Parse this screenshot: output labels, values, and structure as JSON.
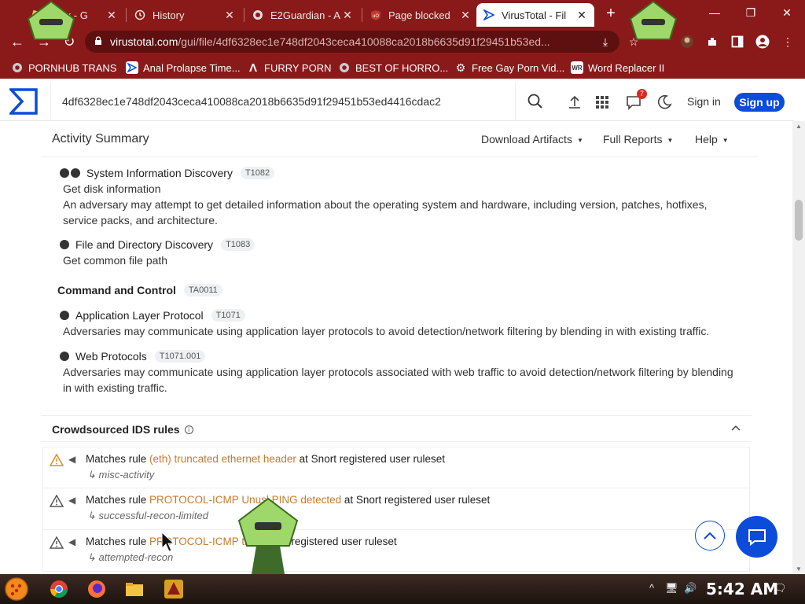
{
  "browser": {
    "tabs": [
      {
        "label": "obux - G",
        "icon": "robux-icon"
      },
      {
        "label": "History",
        "icon": "history-icon"
      },
      {
        "label": "E2Guardian - A",
        "icon": "globe-icon"
      },
      {
        "label": "Page blocked",
        "icon": "ublock-icon"
      },
      {
        "label": "VirusTotal - Fil",
        "icon": "virustotal-icon",
        "active": true
      }
    ],
    "new_tab": "+",
    "window_controls": {
      "minimize": "—",
      "restore": "❐",
      "close": "✕"
    },
    "url_host": "virustotal.com",
    "url_path": "/gui/file/4df6328ec1e748df2043ceca410088ca2018b6635d91f29451b53ed...",
    "bookmarks": [
      {
        "label": "PORNHUB TRANS",
        "icon": "globe-icon"
      },
      {
        "label": "Anal Prolapse Time...",
        "icon": "virustotal-icon"
      },
      {
        "label": "FURRY PORN",
        "icon": "lambda-icon"
      },
      {
        "label": "BEST OF HORRO...",
        "icon": "globe-icon"
      },
      {
        "label": "Free Gay Porn Vid...",
        "icon": "gear-icon"
      },
      {
        "label": "Word Replacer II",
        "icon": "word-replacer-icon"
      }
    ]
  },
  "vt": {
    "search_value": "4df6328ec1e748df2043ceca410088ca2018b6635d91f29451b53ed4416cdac2",
    "notifications_count": "7",
    "sign_in": "Sign in",
    "sign_up": "Sign up"
  },
  "activity": {
    "title": "Activity Summary",
    "menus": [
      "Download Artifacts",
      "Full Reports",
      "Help"
    ],
    "techniques": [
      {
        "name": "System Information Discovery",
        "id": "T1082",
        "detail": "Get disk information",
        "desc": "An adversary may attempt to get detailed information about the operating system and hardware, including version, patches, hotfixes, service packs, and architecture."
      },
      {
        "name": "File and Directory Discovery",
        "id": "T1083",
        "detail": "Get common file path",
        "desc": ""
      }
    ],
    "tactic": {
      "name": "Command and Control",
      "id": "TA0011"
    },
    "c2_techniques": [
      {
        "name": "Application Layer Protocol",
        "id": "T1071",
        "desc": "Adversaries may communicate using application layer protocols to avoid detection/network filtering by blending in with existing traffic."
      },
      {
        "name": "Web Protocols",
        "id": "T1071.001",
        "desc": "Adversaries may communicate using application layer protocols associated with web traffic to avoid detection/network filtering by blending in with existing traffic."
      }
    ]
  },
  "ids": {
    "title": "Crowdsourced IDS rules",
    "rules": [
      {
        "prefix": "Matches rule ",
        "rule": "(eth) truncated ethernet header",
        "suffix": " at Snort registered user ruleset",
        "category": "misc-activity"
      },
      {
        "prefix": "Matches rule ",
        "rule": "PROTOCOL-ICMP Unus",
        "rule_tail": "l PING detected",
        "suffix": " at Snort registered user ruleset",
        "category": "successful-recon-limited"
      },
      {
        "prefix": "Matches rule ",
        "rule": "PROTOCOL-ICMP",
        "rule_tail": " tr",
        "suffix": " at Snort registered user ruleset",
        "category": "attempted-recon"
      }
    ]
  },
  "taskbar": {
    "clock": "5:42 AM"
  }
}
